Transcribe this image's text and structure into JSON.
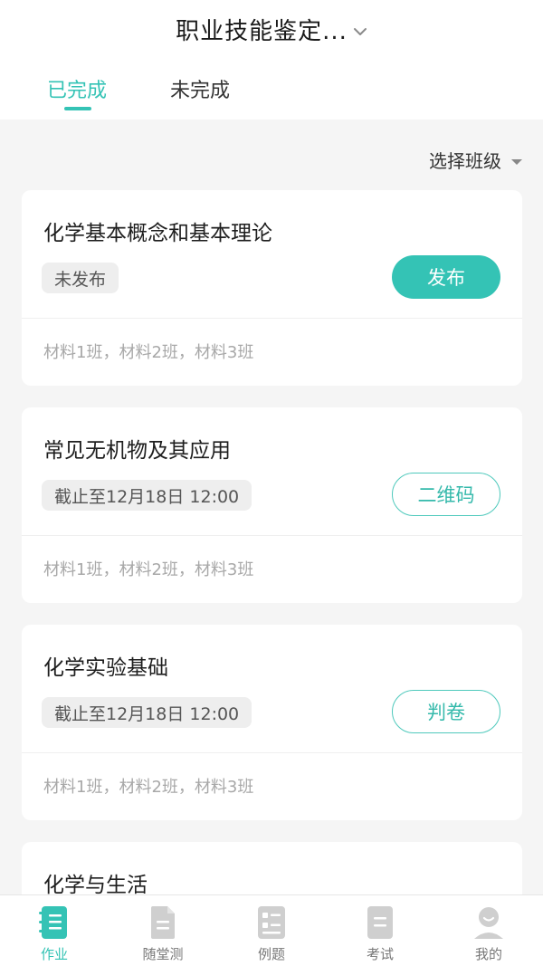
{
  "header": {
    "title": "职业技能鉴定...",
    "title_chevron_icon": "chevron-down-icon"
  },
  "tabs": [
    {
      "label": "已完成",
      "active": true
    },
    {
      "label": "未完成",
      "active": false
    }
  ],
  "filter": {
    "label": "选择班级",
    "caret_icon": "caret-down-icon"
  },
  "cards": [
    {
      "title": "化学基本概念和基本理论",
      "chip": "未发布",
      "action": "发布",
      "action_style": "filled",
      "classes": "材料1班，材料2班，材料3班"
    },
    {
      "title": "常见无机物及其应用",
      "chip": "截止至12月18日 12:00",
      "action": "二维码",
      "action_style": "outline",
      "classes": "材料1班，材料2班，材料3班"
    },
    {
      "title": "化学实验基础",
      "chip": "截止至12月18日 12:00",
      "action": "判卷",
      "action_style": "outline",
      "classes": "材料1班，材料2班，材料3班"
    },
    {
      "title": "化学与生活"
    }
  ],
  "tabbar": {
    "items": [
      {
        "label": "作业",
        "icon": "homework-icon",
        "active": true
      },
      {
        "label": "随堂测",
        "icon": "document-icon",
        "active": false
      },
      {
        "label": "例题",
        "icon": "checklist-icon",
        "active": false
      },
      {
        "label": "考试",
        "icon": "exam-icon",
        "active": false
      },
      {
        "label": "我的",
        "icon": "profile-icon",
        "active": false
      }
    ]
  },
  "colors": {
    "accent": "#34c3b5",
    "background": "#f5f5f5",
    "card": "#ffffff",
    "muted_text": "#a8a8a8",
    "inactive_icon": "#c8c8c8"
  }
}
